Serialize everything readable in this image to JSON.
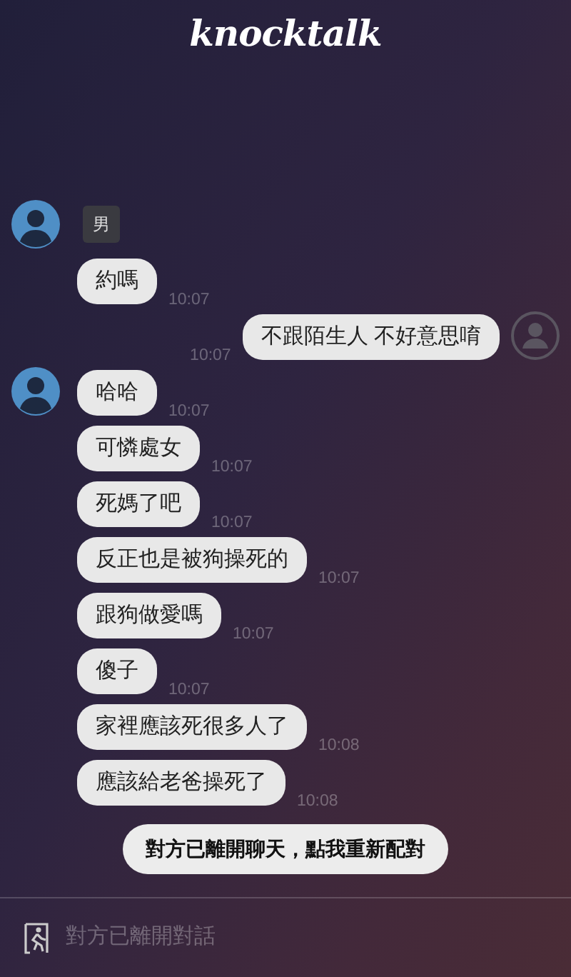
{
  "header": {
    "title": "knocktalk"
  },
  "partner": {
    "gender_tag": "男"
  },
  "messages": [
    {
      "kind": "incoming",
      "text": "約嗎",
      "time": "10:07",
      "avatar": false
    },
    {
      "kind": "outgoing",
      "text": "不跟陌生人 不好意思唷",
      "time": "10:07",
      "avatar": true
    },
    {
      "kind": "incoming",
      "text": "哈哈",
      "time": "10:07",
      "avatar": true
    },
    {
      "kind": "incoming",
      "text": "可憐處女",
      "time": "10:07",
      "avatar": false
    },
    {
      "kind": "incoming",
      "text": "死媽了吧",
      "time": "10:07",
      "avatar": false
    },
    {
      "kind": "incoming",
      "text": "反正也是被狗操死的",
      "time": "10:07",
      "avatar": false
    },
    {
      "kind": "incoming",
      "text": "跟狗做愛嗎",
      "time": "10:07",
      "avatar": false
    },
    {
      "kind": "incoming",
      "text": "傻子",
      "time": "10:07",
      "avatar": false
    },
    {
      "kind": "incoming",
      "text": "家裡應該死很多人了",
      "time": "10:08",
      "avatar": false
    },
    {
      "kind": "incoming",
      "text": "應該給老爸操死了",
      "time": "10:08",
      "avatar": false
    }
  ],
  "rematch_button": "對方已離開聊天，點我重新配對",
  "input": {
    "placeholder": "對方已離開對話",
    "disabled": true
  }
}
